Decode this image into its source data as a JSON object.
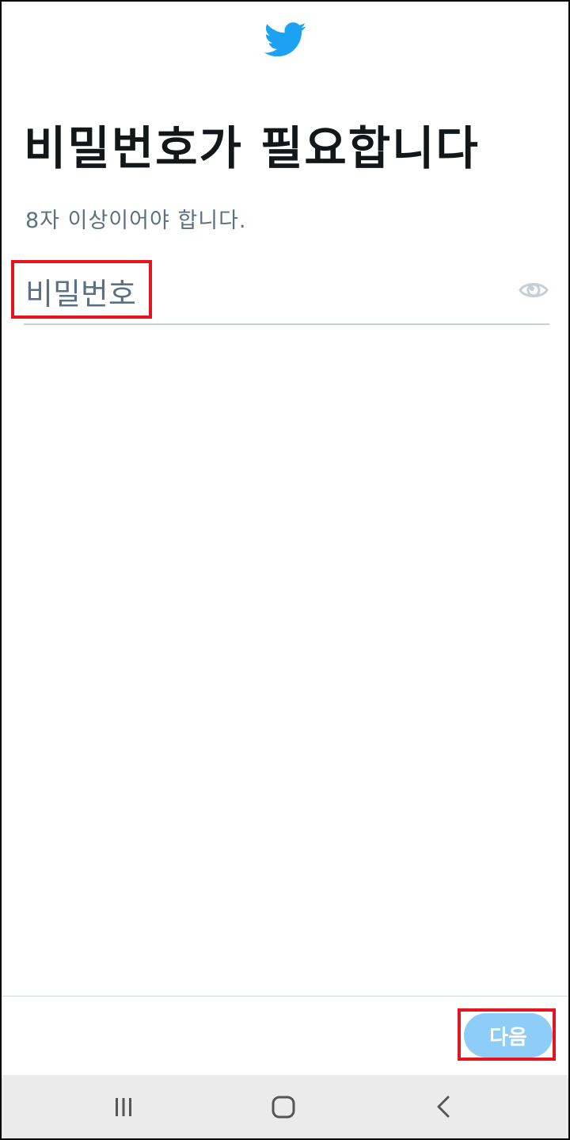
{
  "header": {
    "logo_icon": "twitter-bird-icon",
    "brand_color": "#1da1f2"
  },
  "page": {
    "title": "비밀번호가 필요합니다",
    "subtitle": "8자 이상이어야 합니다."
  },
  "password_field": {
    "placeholder": "비밀번호",
    "value": "",
    "toggle_icon": "eye-icon"
  },
  "footer": {
    "next_label": "다음",
    "next_color": "#8ecdf8"
  },
  "system_nav": {
    "recents_icon": "recent-apps-icon",
    "home_icon": "home-icon",
    "back_icon": "back-icon"
  },
  "highlight_color": "#e3161f"
}
